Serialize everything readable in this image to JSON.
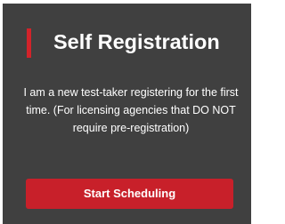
{
  "card": {
    "title": "Self Registration",
    "description": "I am a new test-taker registering for the first time. (For licensing agencies that DO NOT require pre-registration)",
    "button_label": "Start Scheduling"
  },
  "colors": {
    "card_background": "#404040",
    "accent": "#d2232a",
    "button": "#c8202a",
    "text": "#ffffff"
  }
}
